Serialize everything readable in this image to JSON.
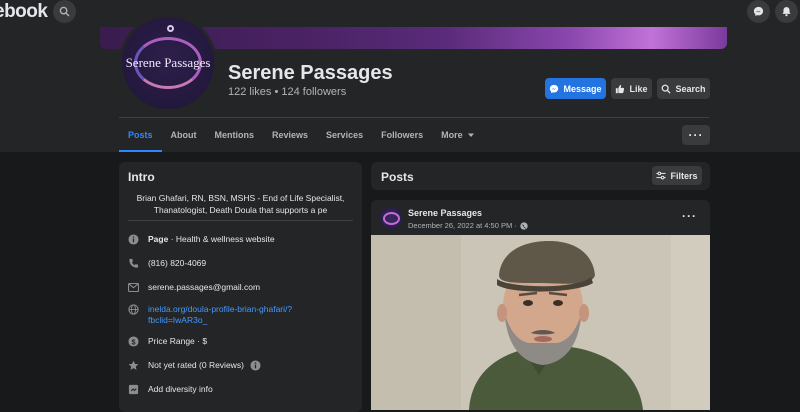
{
  "topbar": {
    "logo_text": "ebook",
    "icons": [
      "search-icon",
      "messenger-icon",
      "bell-icon"
    ]
  },
  "page": {
    "name": "Serene Passages",
    "stats": "122 likes • 124 followers",
    "avatar_text": "Serene Passages"
  },
  "actions": {
    "message": "Message",
    "like": "Like",
    "search": "Search"
  },
  "tabs": [
    "Posts",
    "About",
    "Mentions",
    "Reviews",
    "Services",
    "Followers",
    "More"
  ],
  "intro": {
    "title": "Intro",
    "bio_line1": "Brian Ghafari, RN, BSN, MSHS - End of Life Specialist,",
    "bio_line2": "Thanatologist, Death Doula that supports a pe",
    "page_type_bold": "Page",
    "page_type_rest": " · Health & wellness website",
    "phone": "(816) 820-4069",
    "email": "serene.passages@gmail.com",
    "website_line1": "inelda.org/doula-profile-brian-ghafari/?",
    "website_line2": "fbclid=IwAR3o_",
    "price_range": "Price Range · $",
    "rating": "Not yet rated (0 Reviews)",
    "diversity": "Add diversity info"
  },
  "posts": {
    "title": "Posts",
    "filters": "Filters",
    "post_author": "Serene Passages",
    "post_date": "December 26, 2022 at 4:50 PM ·"
  },
  "colors": {
    "accent": "#2d88ff",
    "primary_button": "#2374e1",
    "card": "#242526",
    "background": "#18191a"
  }
}
